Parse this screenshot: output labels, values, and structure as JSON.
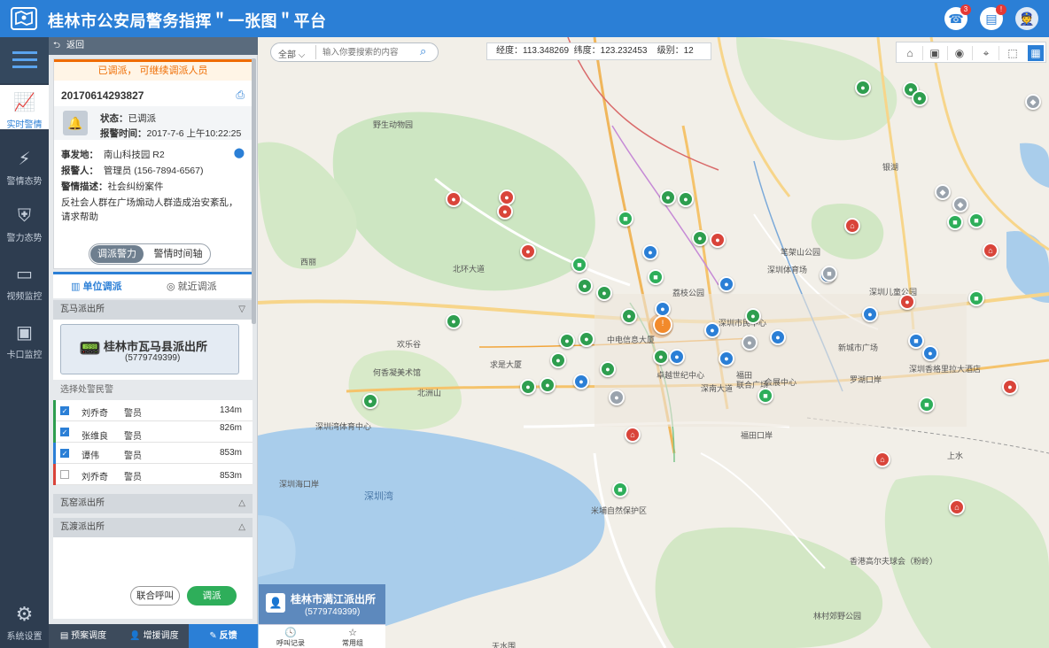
{
  "header": {
    "title": "桂林市公安局警务指挥＂一张图＂平台",
    "phone_badge": "3",
    "doc_badge": "!"
  },
  "nav": {
    "items": [
      {
        "label": "实时警情",
        "icon": "chart-icon"
      },
      {
        "label": "警情态势",
        "icon": "siren-icon"
      },
      {
        "label": "警力态势",
        "icon": "shield-icon"
      },
      {
        "label": "视频监控",
        "icon": "camera-icon"
      },
      {
        "label": "卡口监控",
        "icon": "checkpoint-icon"
      }
    ],
    "settings_label": "系统设置"
  },
  "panel": {
    "back_label": "返回",
    "status_banner": "已调派， 可继续调派人员",
    "case_id": "20170614293827",
    "status_label": "状态：",
    "status_value": "已调派",
    "report_time_label": "报警时间：",
    "report_time_value": "2017-7-6  上午10:22:25",
    "location_label": "事发地：",
    "location_value": "南山科技园 R2",
    "reporter_label": "报警人：",
    "reporter_value": "管理员 (156-7894-6567)",
    "desc_label": "警情描述：",
    "desc_value": "社会纠纷案件",
    "desc_detail": "反社会人群在广场煽动人群造成治安紊乱，请求帮助",
    "tabs": [
      "调派警力",
      "警情时间轴"
    ],
    "sub_tabs": [
      "单位调派",
      "就近调派"
    ],
    "section_1": "瓦马派出所",
    "station_name": "桂林市瓦马县派出所",
    "station_phone": "(5779749399)",
    "officer_section": "选择处警民警",
    "officers": [
      {
        "name": "刘乔奇",
        "rank": "警员",
        "dist": "134m",
        "checked": true,
        "color": "#2e9e4f"
      },
      {
        "name": "张维良",
        "rank": "警员",
        "dist": "826m",
        "checked": true,
        "color": "#2e9e4f"
      },
      {
        "name": "谭伟",
        "rank": "警员",
        "dist": "853m",
        "checked": true,
        "color": "#2b7fd6"
      },
      {
        "name": "刘乔奇",
        "rank": "警员",
        "dist": "853m",
        "checked": false,
        "color": "#d9443a"
      }
    ],
    "section_2": "瓦窑派出所",
    "section_3": "瓦渡派出所",
    "joint_call_btn": "联合呼叫",
    "dispatch_btn": "调派"
  },
  "bottom_tabs": [
    "预案调度",
    "增援调度",
    "反馈"
  ],
  "map": {
    "search_scope": "全部",
    "search_placeholder": "输入你要搜索的内容",
    "coords": {
      "lng_label": "经度：",
      "lng": "113.348269",
      "lat_label": "纬度：",
      "lat": "123.232453",
      "level_label": "级别：",
      "level": "12"
    },
    "labels": [
      "野生动物园",
      "西丽",
      "北环大道",
      "福田",
      "欢乐谷",
      "何香凝美术馆",
      "北洲山",
      "深圳湾",
      "深圳海口岸",
      "深圳体育场",
      "深圳儿童公园",
      "深圳市民中心",
      "会展中心",
      "福田口岸",
      "罗湖口岸",
      "深圳香格里拉大酒店",
      "新城市广场",
      "联合广场",
      "卓越世纪中心",
      "中电信息大厦",
      "深南大道",
      "求是大厦",
      "深圳湾体育中心",
      "米埔自然保护区",
      "香港高尔夫球会（粉岭）",
      "林村郊野公园",
      "天水围",
      "银湖",
      "笔架山公园",
      "荔枝公园",
      "上水"
    ],
    "station_card_name": "桂林市满江派出所",
    "station_card_phone": "(5779749399)",
    "call_tabs": [
      "呼叫记录",
      "常用组"
    ]
  }
}
